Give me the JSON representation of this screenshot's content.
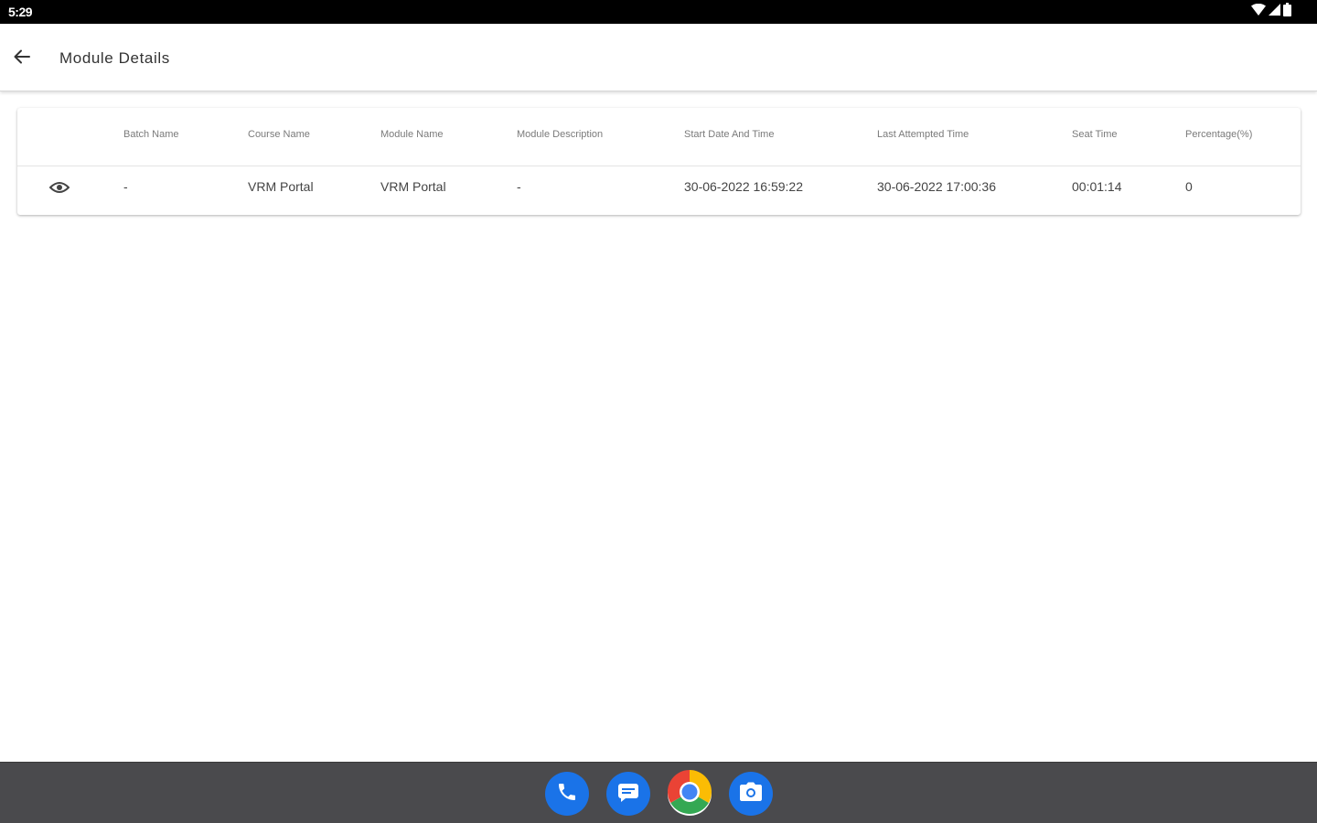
{
  "status_bar": {
    "time": "5:29",
    "icons": [
      "wifi-icon",
      "signal-icon",
      "battery-icon"
    ]
  },
  "app_bar": {
    "title": "Module Details",
    "back_icon": "back-arrow-icon"
  },
  "table": {
    "columns": [
      "",
      "Batch Name",
      "Course Name",
      "Module Name",
      "Module Description",
      "Start Date And Time",
      "Last Attempted Time",
      "Seat Time",
      "Percentage(%)"
    ],
    "rows": [
      {
        "action_icon": "eye-icon",
        "cells": [
          "-",
          "VRM Portal",
          "VRM Portal",
          "-",
          "30-06-2022 16:59:22",
          "30-06-2022 17:00:36",
          "00:01:14",
          "0"
        ]
      }
    ]
  },
  "taskbar": {
    "apps": [
      {
        "name": "phone-app",
        "icon": "phone-icon",
        "color": "#1a73e8"
      },
      {
        "name": "messages-app",
        "icon": "message-icon",
        "color": "#1a73e8"
      },
      {
        "name": "chrome-app",
        "icon": "chrome-icon",
        "color": "#ea4335"
      },
      {
        "name": "camera-app",
        "icon": "camera-icon",
        "color": "#1a73e8"
      }
    ]
  },
  "colors": {
    "status_bar": "#000000",
    "taskbar": "#4a4a4d",
    "accent_blue": "#1a73e8"
  }
}
